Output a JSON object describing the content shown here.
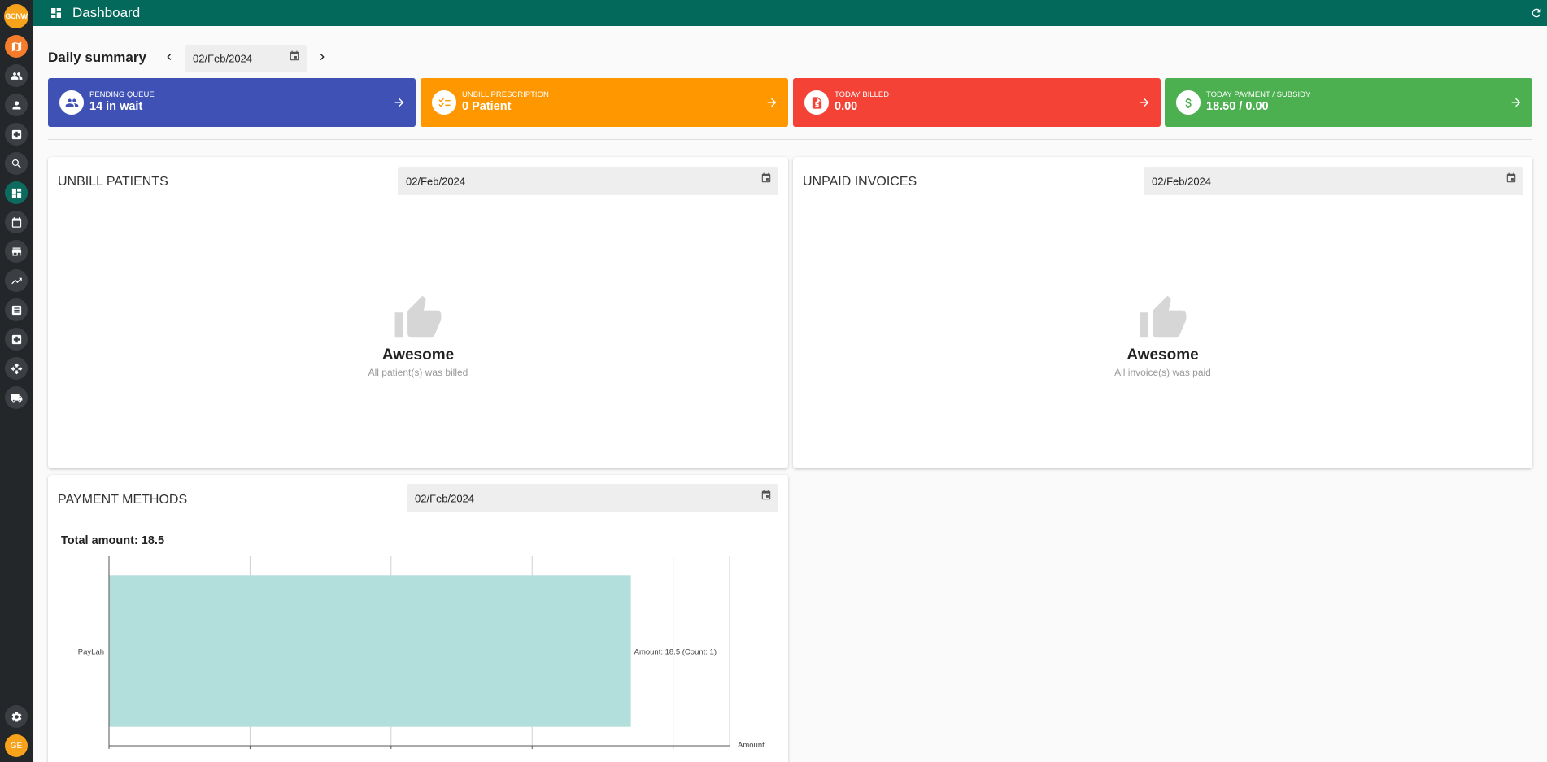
{
  "sidebar": {
    "logo_text": "GCNW",
    "avatar_initials": "GE",
    "items": [
      {
        "icon": "map-icon",
        "style": "orange"
      },
      {
        "icon": "group-icon",
        "style": "default"
      },
      {
        "icon": "person-icon",
        "style": "default"
      },
      {
        "icon": "medical-box-icon",
        "style": "default"
      },
      {
        "icon": "search-icon",
        "style": "default"
      },
      {
        "icon": "dashboard-icon",
        "style": "active"
      },
      {
        "icon": "calendar-icon",
        "style": "default"
      },
      {
        "icon": "store-icon",
        "style": "default"
      },
      {
        "icon": "trending-up-icon",
        "style": "default"
      },
      {
        "icon": "document-icon",
        "style": "default"
      },
      {
        "icon": "medical-box-icon",
        "style": "default"
      },
      {
        "icon": "move-icon",
        "style": "default"
      },
      {
        "icon": "truck-icon",
        "style": "default"
      },
      {
        "icon": "gear-icon",
        "style": "default"
      }
    ]
  },
  "header": {
    "title": "Dashboard"
  },
  "daily_summary": {
    "title": "Daily summary",
    "date": "02/Feb/2024"
  },
  "cards": [
    {
      "label": "PENDING QUEUE",
      "value": "14 in wait",
      "color": "#3f51b5",
      "icon": "group-icon"
    },
    {
      "label": "UNBILL PRESCRIPTION",
      "value": "0 Patient",
      "color": "#ff9800",
      "icon": "checklist-icon"
    },
    {
      "label": "TODAY BILLED",
      "value": "0.00",
      "color": "#f44336",
      "icon": "invoice-icon"
    },
    {
      "label": "TODAY PAYMENT / SUBSIDY",
      "value": "18.50 / 0.00",
      "color": "#4caf50",
      "icon": "dollar-icon"
    }
  ],
  "unbill_patients": {
    "title": "UNBILL PATIENTS",
    "date": "02/Feb/2024",
    "empty_title": "Awesome",
    "empty_subtitle": "All patient(s) was billed"
  },
  "unpaid_invoices": {
    "title": "UNPAID INVOICES",
    "date": "02/Feb/2024",
    "empty_title": "Awesome",
    "empty_subtitle": "All invoice(s) was paid"
  },
  "payment_methods": {
    "title": "PAYMENT METHODS",
    "date": "02/Feb/2024",
    "total_label": "Total amount: 18.5"
  },
  "chart_data": {
    "type": "bar",
    "orientation": "horizontal",
    "categories": [
      "PayLah"
    ],
    "values": [
      18.5
    ],
    "data_labels": [
      "Amount: 18.5 (Count: 1)"
    ],
    "xlabel": "Amount",
    "xlim": [
      0,
      22
    ],
    "grid": true,
    "bar_color": "#b2dfdb"
  }
}
